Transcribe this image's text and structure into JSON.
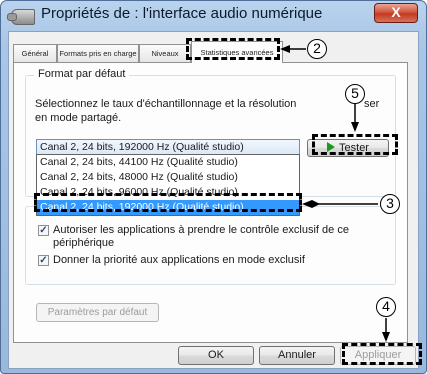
{
  "window": {
    "title": "Propriétés de : l'interface audio numérique",
    "close_label": "X"
  },
  "tabs": [
    {
      "label": "Général"
    },
    {
      "label": "Formats pris en charge"
    },
    {
      "label": "Niveaux"
    },
    {
      "label": "Statistiques avancées"
    }
  ],
  "default_format": {
    "group_title": "Format par défaut",
    "description_line1": "Sélectionnez le taux d'échantillonnage et la résolution",
    "description_tail": "ser",
    "description_line2": "en mode partagé.",
    "selected_value": "Canal 2, 24 bits, 192000 Hz (Qualité studio)",
    "options": [
      "Canal 2, 24 bits, 44100 Hz (Qualité studio)",
      "Canal 2, 24 bits, 48000 Hz (Qualité studio)",
      "Canal 2, 24 bits, 96000 Hz (Qualité studio)",
      "Canal 2, 24 bits, 192000 Hz (Qualité studio)"
    ],
    "test_label": "Tester"
  },
  "exclusive_mode": {
    "checkbox1_line1": "Autoriser les applications à prendre le contrôle exclusif de ce",
    "checkbox1_line2": "périphérique",
    "checkbox2": "Donner la priorité aux applications en mode exclusif",
    "checked1": true,
    "checked2": true
  },
  "buttons": {
    "defaults": "Paramètres par défaut",
    "ok": "OK",
    "cancel": "Annuler",
    "apply": "Appliquer"
  },
  "callouts": [
    "2",
    "5",
    "3",
    "4"
  ],
  "colors": {
    "selection": "#3399ff",
    "play_icon": "#1a9c1a",
    "close_button": "#c23a22"
  }
}
